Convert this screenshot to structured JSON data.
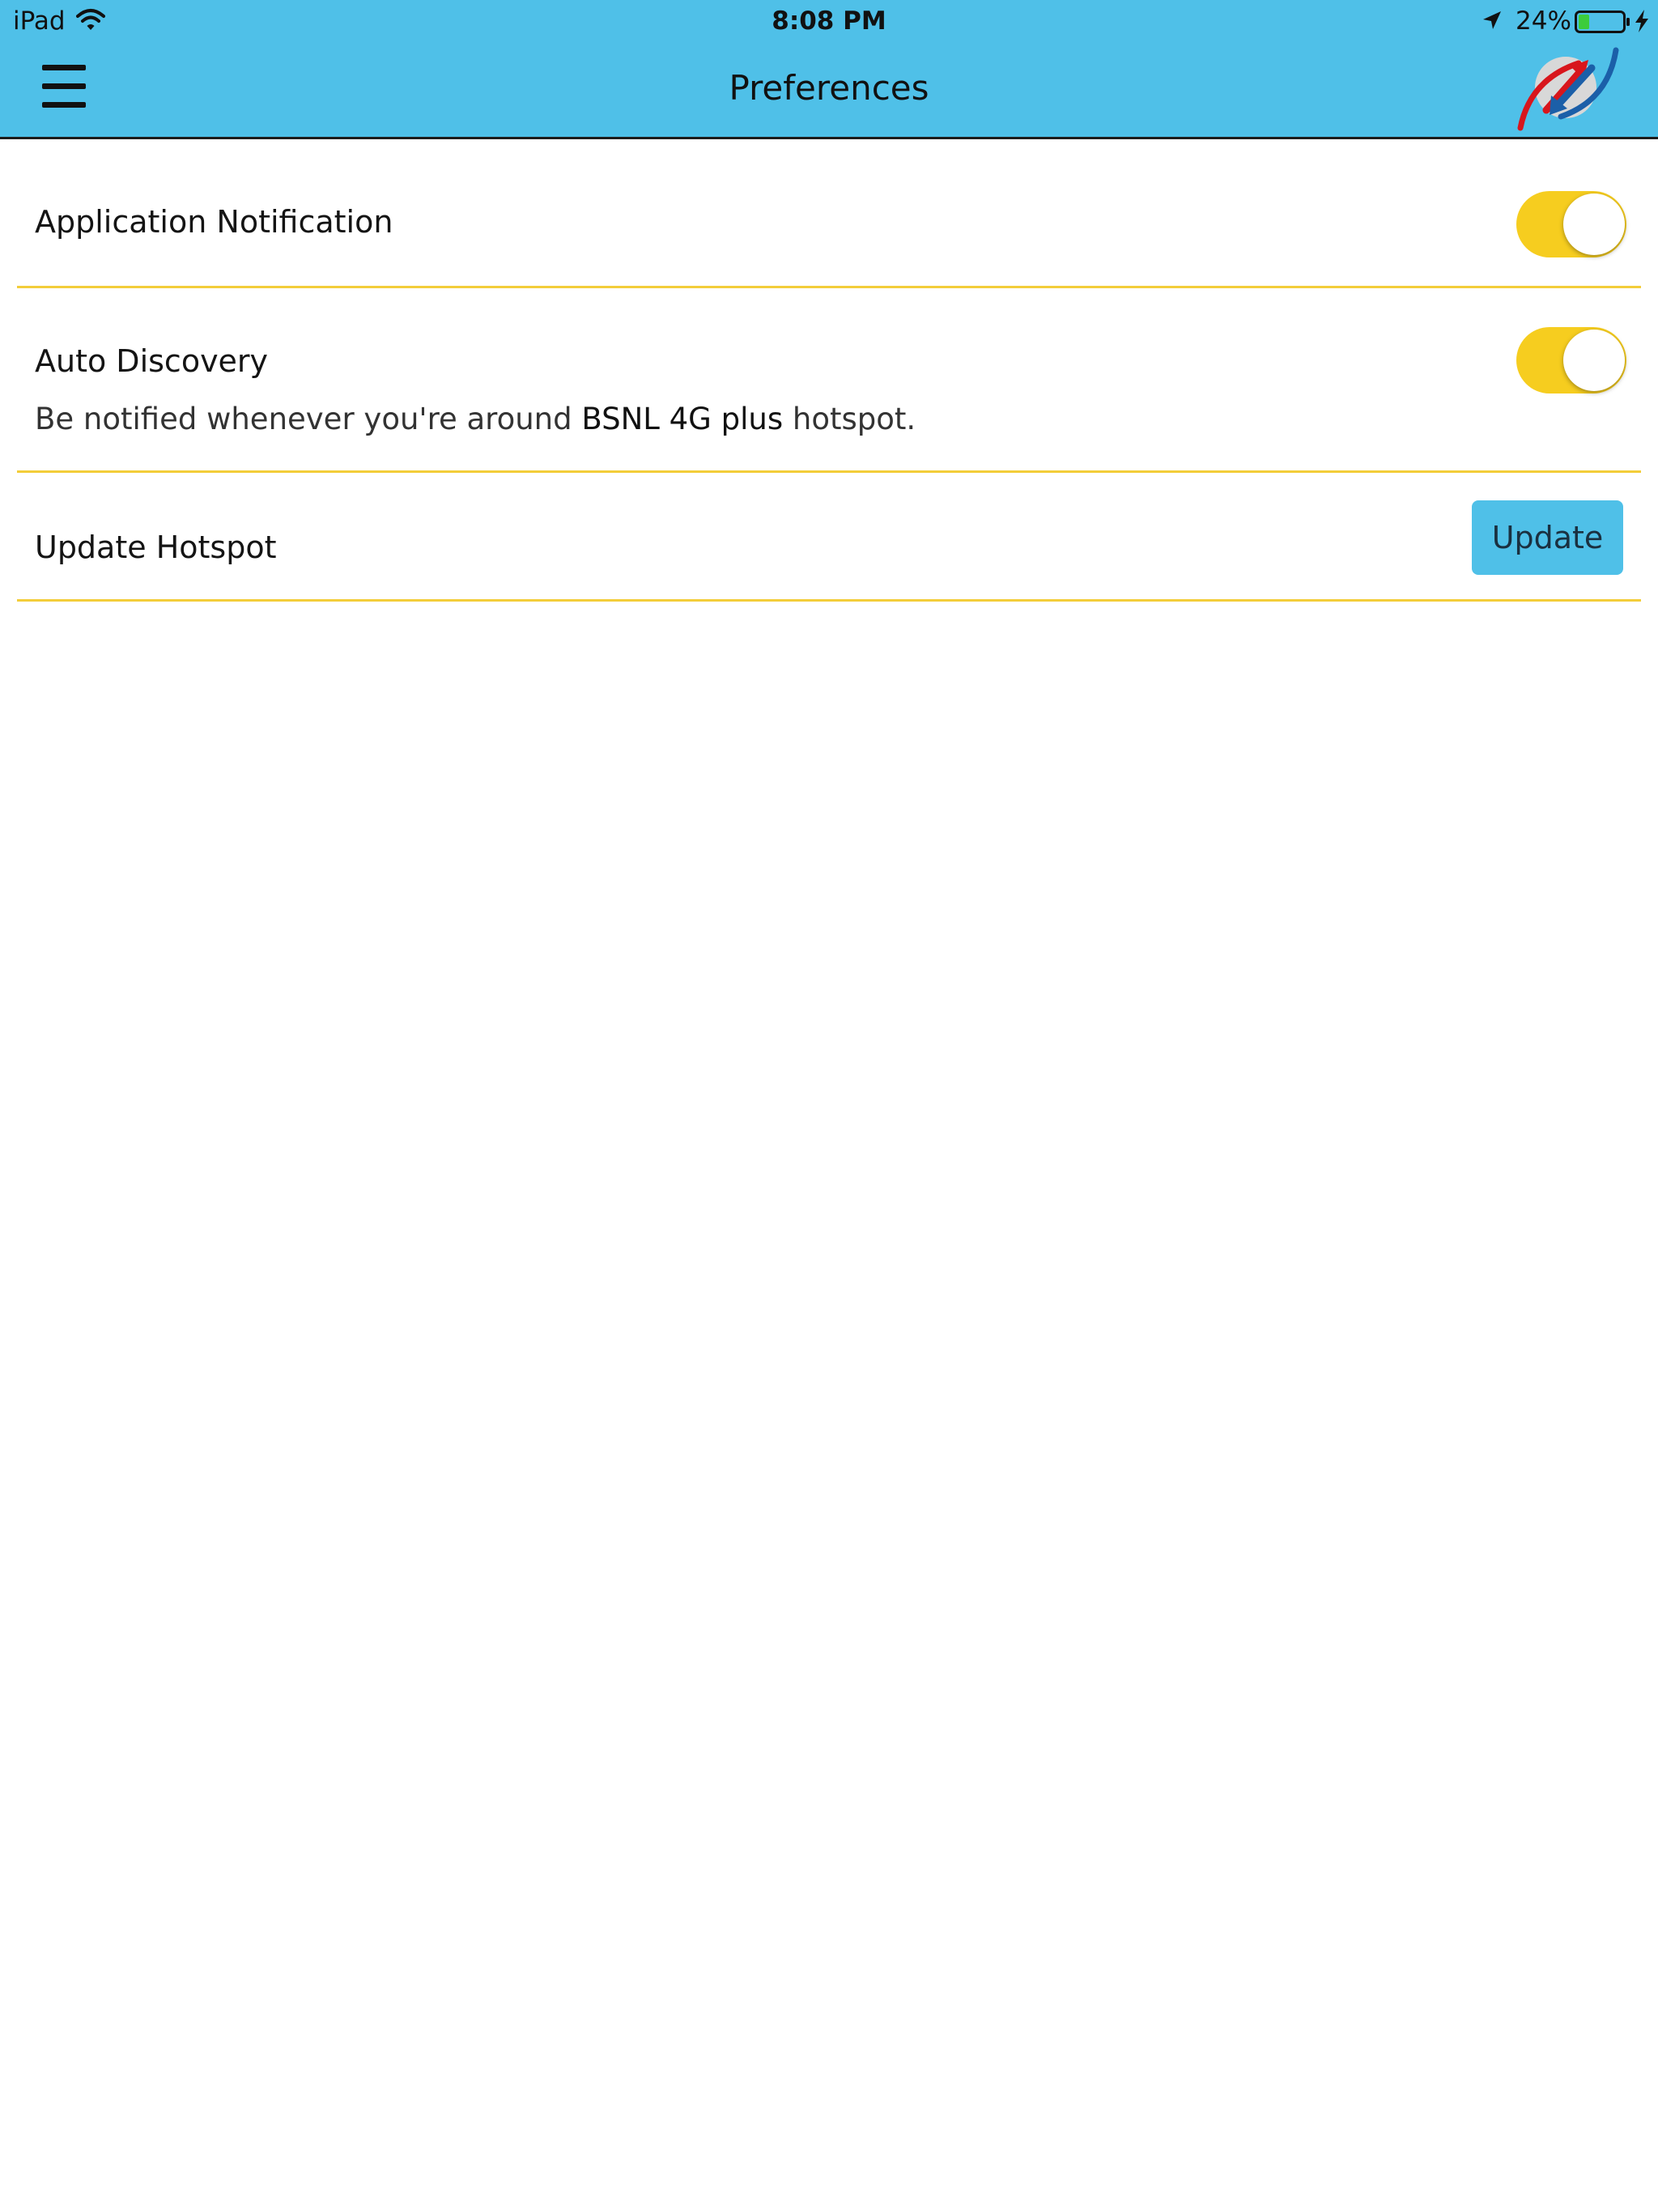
{
  "status_bar": {
    "device": "iPad",
    "time": "8:08 PM",
    "battery_percent": "24%",
    "battery_level": 0.24,
    "icons": [
      "wifi-icon",
      "location-arrow-icon",
      "battery-icon",
      "charging-bolt-icon"
    ]
  },
  "header": {
    "title": "Preferences",
    "menu_icon": "hamburger-menu-icon",
    "logo": "bsnl-logo"
  },
  "settings": {
    "application_notification": {
      "label": "Application Notification",
      "enabled": true
    },
    "auto_discovery": {
      "label": "Auto Discovery",
      "description_prefix": "Be notified whenever you're around ",
      "description_highlight": "BSNL 4G plus",
      "description_suffix": " hotspot.",
      "enabled": true
    },
    "update_hotspot": {
      "label": "Update Hotspot",
      "button_label": "Update"
    }
  },
  "colors": {
    "header_bg": "#4fc0e8",
    "toggle_on": "#f6cd1f",
    "divider": "#f3cd3a",
    "button_bg": "#4fc0e8"
  }
}
